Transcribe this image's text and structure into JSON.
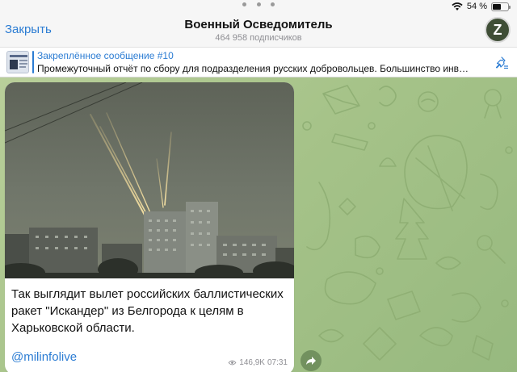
{
  "status": {
    "battery_percent": "54 %",
    "battery_level": 0.54,
    "icons": [
      "wifi-icon",
      "battery-icon"
    ]
  },
  "header": {
    "close_label": "Закрыть",
    "channel_title": "Военный Осведомитель",
    "subscribers": "464 958 подписчиков",
    "avatar_letter": "Z"
  },
  "pinned": {
    "title": "Закреплённое сообщение #10",
    "text": "Промежуточный отчёт по сбору для подразделения русских добровольцев.    Большинство инв…"
  },
  "message": {
    "text": "Так выглядит вылет российских баллистических ракет \"Искандер\" из Белгорода к целям в Харьковской области.",
    "link": "@milinfolive",
    "views": "146,9K",
    "time": "07:31"
  },
  "colors": {
    "accent": "#2b7cd3",
    "chat_bg": "#a6c389",
    "bubble": "#ffffff",
    "muted": "#8e8e93"
  }
}
